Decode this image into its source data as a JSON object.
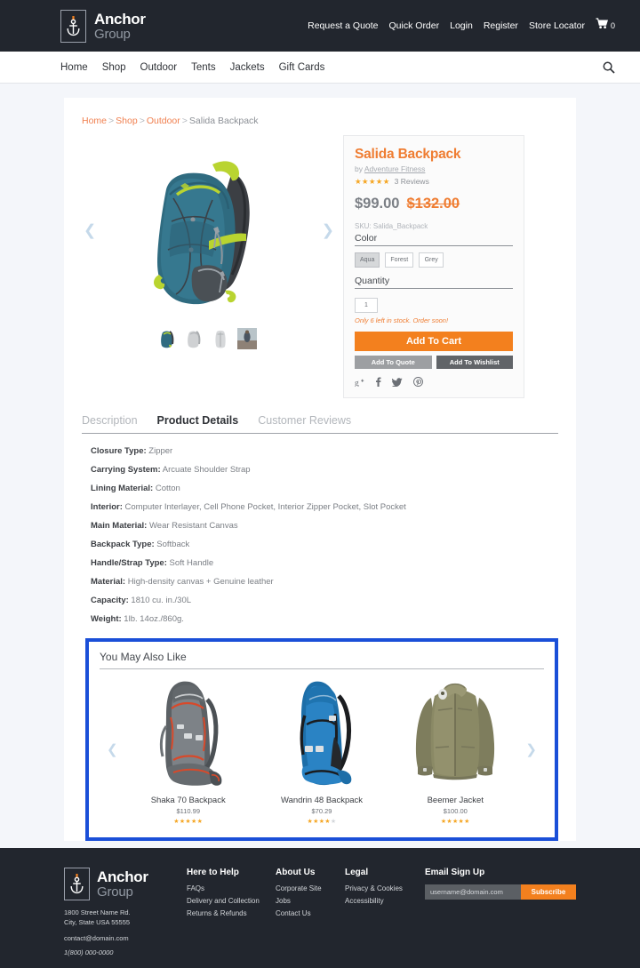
{
  "brand": {
    "name_line1": "Anchor",
    "name_line2": "Group",
    "logo_icon": "anchor-icon",
    "accent_color": "#f3801e",
    "dark_color": "#22262e"
  },
  "topbar": {
    "links": [
      {
        "label": "Request a Quote"
      },
      {
        "label": "Quick Order"
      },
      {
        "label": "Login"
      },
      {
        "label": "Register"
      },
      {
        "label": "Store Locator"
      }
    ],
    "cart": {
      "icon": "shopping-cart-icon",
      "count": "0"
    }
  },
  "nav": {
    "items": [
      {
        "label": "Home"
      },
      {
        "label": "Shop"
      },
      {
        "label": "Outdoor"
      },
      {
        "label": "Tents"
      },
      {
        "label": "Jackets"
      },
      {
        "label": "Gift Cards"
      }
    ],
    "search_icon": "search-icon"
  },
  "breadcrumb": {
    "items": [
      {
        "label": "Home",
        "link": true
      },
      {
        "label": "Shop",
        "link": true
      },
      {
        "label": "Outdoor",
        "link": true
      },
      {
        "label": "Salida Backpack",
        "link": false
      }
    ],
    "separator": ">"
  },
  "gallery": {
    "prev_arrow": "chevron-left-icon",
    "next_arrow": "chevron-right-icon",
    "thumbnails": [
      {
        "name": "thumb-aqua-backpack"
      },
      {
        "name": "thumb-grey-backpack"
      },
      {
        "name": "thumb-grey-backpack-back"
      },
      {
        "name": "thumb-lifestyle-photo"
      }
    ]
  },
  "product": {
    "title": "Salida Backpack",
    "by_prefix": "by",
    "brand_link": "Adventure Fitness",
    "rating": 4.5,
    "reviews_text": "3 Reviews",
    "price_current": "$99.00",
    "price_original": "$132.00",
    "sku_text": "SKU: Salida_Backpack",
    "color_label": "Color",
    "color_options": [
      {
        "label": "Aqua",
        "selected": true
      },
      {
        "label": "Forest",
        "selected": false
      },
      {
        "label": "Grey",
        "selected": false
      }
    ],
    "quantity_label": "Quantity",
    "quantity_value": "1",
    "stock_message": "Only 6 left in stock. Order soon!",
    "add_to_cart_label": "Add To Cart",
    "add_to_quote_label": "Add To Quote",
    "add_to_wishlist_label": "Add To Wishlist",
    "social": [
      {
        "name": "google-plus-icon",
        "glyph": "g+"
      },
      {
        "name": "facebook-icon",
        "glyph": "f"
      },
      {
        "name": "twitter-icon",
        "glyph": "t"
      },
      {
        "name": "pinterest-icon",
        "glyph": "p"
      }
    ]
  },
  "tabs": [
    {
      "label": "Description",
      "active": false
    },
    {
      "label": "Product Details",
      "active": true
    },
    {
      "label": "Customer Reviews",
      "active": false
    }
  ],
  "details": [
    {
      "label": "Closure Type:",
      "value": "Zipper"
    },
    {
      "label": "Carrying System:",
      "value": "Arcuate Shoulder Strap"
    },
    {
      "label": "Lining Material:",
      "value": "Cotton"
    },
    {
      "label": "Interior:",
      "value": "Computer Interlayer, Cell Phone Pocket, Interior Zipper Pocket, Slot Pocket"
    },
    {
      "label": "Main Material:",
      "value": "Wear Resistant Canvas"
    },
    {
      "label": "Backpack Type:",
      "value": "Softback"
    },
    {
      "label": "Handle/Strap Type:",
      "value": "Soft Handle"
    },
    {
      "label": "Material:",
      "value": "High-density canvas + Genuine leather"
    },
    {
      "label": "Capacity:",
      "value": "1810 cu. in./30L"
    },
    {
      "label": "Weight:",
      "value": "1lb. 14oz./860g."
    }
  ],
  "also_like": {
    "title": "You May Also Like",
    "highlight_color": "#1a4fd8",
    "prev_arrow": "chevron-left-icon",
    "next_arrow": "chevron-right-icon",
    "products": [
      {
        "name": "Shaka 70 Backpack",
        "price": "$110.99",
        "rating": 5
      },
      {
        "name": "Wandrin 48 Backpack",
        "price": "$70.29",
        "rating": 4
      },
      {
        "name": "Beemer Jacket",
        "price": "$100.00",
        "rating": 4.5
      }
    ]
  },
  "footer": {
    "address_line1": "1800 Street Name Rd.",
    "address_line2": "City, State USA 55555",
    "email": "contact@domain.com",
    "phone": "1(800) 000-0000",
    "columns": [
      {
        "heading": "Here to Help",
        "links": [
          {
            "label": "FAQs"
          },
          {
            "label": "Delivery and Collection"
          },
          {
            "label": "Returns & Refunds"
          }
        ]
      },
      {
        "heading": "About Us",
        "links": [
          {
            "label": "Corporate Site"
          },
          {
            "label": "Jobs"
          },
          {
            "label": "Contact Us"
          }
        ]
      },
      {
        "heading": "Legal",
        "links": [
          {
            "label": "Privacy & Cookies"
          },
          {
            "label": "Accessibility"
          }
        ]
      }
    ],
    "signup": {
      "heading": "Email Sign Up",
      "placeholder": "username@domain.com",
      "value": "",
      "button_label": "Subscribe"
    }
  }
}
